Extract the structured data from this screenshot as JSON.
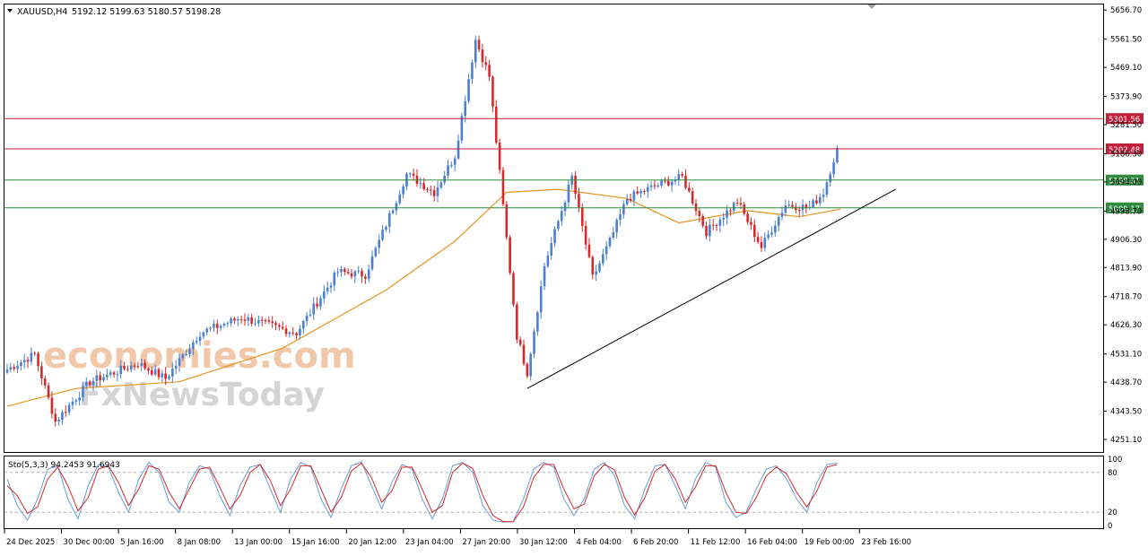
{
  "chart_data": [
    {
      "type": "candlestick",
      "symbol_label": "XAUUSD,H4",
      "ohlc_label": "5192.12 5199.63 5180.57 5198.28",
      "ylim": [
        4210,
        5675
      ],
      "y_ticks": [
        "5656.70",
        "5561.50",
        "5469.10",
        "5373.90",
        "5281.50",
        "5186.30",
        "5094.00",
        "4998.70",
        "4906.30",
        "4813.90",
        "4718.70",
        "4626.30",
        "4531.10",
        "4438.70",
        "4343.50",
        "4251.10"
      ],
      "x_ticks": [
        "24 Dec 2025",
        "30 Dec 00:00",
        "5 Jan 16:00",
        "8 Jan 08:00",
        "13 Jan 00:00",
        "15 Jan 16:00",
        "20 Jan 12:00",
        "23 Jan 04:00",
        "27 Jan 20:00",
        "30 Jan 12:00",
        "4 Feb 04:00",
        "6 Feb 20:00",
        "11 Feb 12:00",
        "16 Feb 04:00",
        "19 Feb 00:00",
        "23 Feb 16:00"
      ],
      "up_color": "#4a7fd4",
      "down_color": "#d42a2a",
      "close_path": [
        {
          "bar": 0,
          "price": 4480
        },
        {
          "bar": 8,
          "price": 4530
        },
        {
          "bar": 14,
          "price": 4310
        },
        {
          "bar": 24,
          "price": 4440
        },
        {
          "bar": 38,
          "price": 4500
        },
        {
          "bar": 46,
          "price": 4450
        },
        {
          "bar": 56,
          "price": 4600
        },
        {
          "bar": 68,
          "price": 4650
        },
        {
          "bar": 84,
          "price": 4600
        },
        {
          "bar": 96,
          "price": 4800
        },
        {
          "bar": 104,
          "price": 4790
        },
        {
          "bar": 116,
          "price": 5120
        },
        {
          "bar": 124,
          "price": 5060
        },
        {
          "bar": 130,
          "price": 5180
        },
        {
          "bar": 136,
          "price": 5560
        },
        {
          "bar": 140,
          "price": 5440
        },
        {
          "bar": 148,
          "price": 4590
        },
        {
          "bar": 151,
          "price": 4470
        },
        {
          "bar": 156,
          "price": 4820
        },
        {
          "bar": 164,
          "price": 5110
        },
        {
          "bar": 170,
          "price": 4780
        },
        {
          "bar": 175,
          "price": 4900
        },
        {
          "bar": 180,
          "price": 5040
        },
        {
          "bar": 188,
          "price": 5080
        },
        {
          "bar": 196,
          "price": 5110
        },
        {
          "bar": 203,
          "price": 4930
        },
        {
          "bar": 212,
          "price": 5030
        },
        {
          "bar": 219,
          "price": 4880
        },
        {
          "bar": 226,
          "price": 5020
        },
        {
          "bar": 233,
          "price": 5010
        },
        {
          "bar": 237,
          "price": 5060
        },
        {
          "bar": 241,
          "price": 5205
        }
      ],
      "moving_average": {
        "color": "#e8931e",
        "points": [
          {
            "bar": 0,
            "price": 4360
          },
          {
            "bar": 20,
            "price": 4418
          },
          {
            "bar": 50,
            "price": 4440
          },
          {
            "bar": 80,
            "price": 4550
          },
          {
            "bar": 110,
            "price": 4740
          },
          {
            "bar": 130,
            "price": 4900
          },
          {
            "bar": 145,
            "price": 5060
          },
          {
            "bar": 160,
            "price": 5070
          },
          {
            "bar": 180,
            "price": 5040
          },
          {
            "bar": 195,
            "price": 4960
          },
          {
            "bar": 215,
            "price": 5000
          },
          {
            "bar": 230,
            "price": 4980
          },
          {
            "bar": 242,
            "price": 5005
          }
        ]
      },
      "horizontal_levels": [
        {
          "label": "5301.56",
          "price": 5301.56,
          "color": "#c0203a"
        },
        {
          "label": "5202.48",
          "price": 5202.48,
          "color": "#c0203a"
        },
        {
          "label": "5100.31",
          "price": 5100.31,
          "color": "#2e8b3e"
        },
        {
          "label": "5009.17",
          "price": 5009.17,
          "color": "#2e8b3e"
        }
      ],
      "trend_line": {
        "color": "#000000",
        "from": {
          "bar": 151,
          "price": 4418
        },
        "to": {
          "bar": 258,
          "price": 5070
        }
      },
      "watermark": [
        "economies.com",
        "FxNewsToday"
      ]
    },
    {
      "type": "line",
      "title": "Sto(5,3,3) 94.2453 91.6943",
      "ylim": [
        0,
        100
      ],
      "y_ticks": [
        "100",
        "80",
        "20",
        "0"
      ],
      "levels": [
        80,
        20
      ],
      "series": [
        {
          "name": "main",
          "color": "#6a9ad8",
          "values": [
            70,
            30,
            8,
            40,
            85,
            90,
            40,
            10,
            60,
            92,
            88,
            50,
            20,
            70,
            95,
            80,
            35,
            20,
            65,
            90,
            85,
            45,
            15,
            60,
            88,
            92,
            55,
            20,
            70,
            95,
            88,
            40,
            12,
            55,
            90,
            96,
            60,
            25,
            65,
            92,
            85,
            40,
            10,
            40,
            90,
            95,
            80,
            30,
            8,
            5,
            6,
            40,
            85,
            95,
            88,
            40,
            15,
            40,
            85,
            95,
            75,
            30,
            10,
            55,
            90,
            92,
            60,
            25,
            70,
            95,
            88,
            35,
            12,
            20,
            55,
            85,
            90,
            70,
            40,
            20,
            65,
            92,
            94
          ]
        },
        {
          "name": "signal",
          "color": "#d42a2a",
          "values": [
            60,
            45,
            18,
            28,
            70,
            88,
            60,
            22,
            42,
            85,
            90,
            65,
            30,
            55,
            90,
            85,
            50,
            25,
            55,
            85,
            88,
            58,
            25,
            45,
            80,
            92,
            68,
            30,
            55,
            90,
            90,
            55,
            20,
            42,
            82,
            94,
            72,
            35,
            52,
            88,
            88,
            55,
            20,
            30,
            80,
            94,
            86,
            45,
            15,
            6,
            6,
            28,
            72,
            92,
            92,
            55,
            25,
            32,
            75,
            92,
            84,
            42,
            16,
            42,
            82,
            92,
            70,
            35,
            58,
            90,
            90,
            50,
            20,
            18,
            42,
            75,
            88,
            78,
            50,
            28,
            52,
            88,
            92
          ]
        }
      ]
    }
  ]
}
